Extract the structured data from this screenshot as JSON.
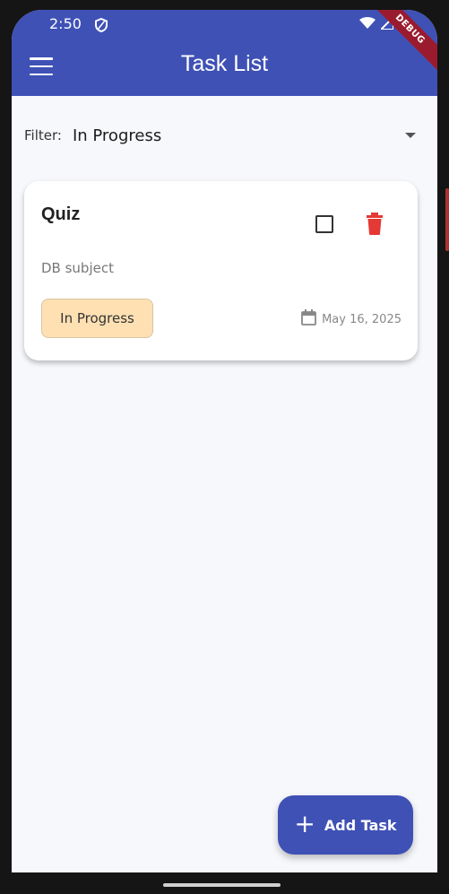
{
  "status_bar": {
    "time": "2:50"
  },
  "app_bar": {
    "title": "Task List",
    "debug_label": "DEBUG"
  },
  "filter": {
    "label": "Filter:",
    "selected": "In Progress"
  },
  "tasks": [
    {
      "title": "Quiz",
      "description": "DB subject",
      "status": "In Progress",
      "date": "May 16, 2025",
      "status_color": "#ffe0b2"
    }
  ],
  "fab": {
    "label": "Add Task"
  },
  "colors": {
    "primary": "#3f51b5",
    "delete": "#e53935",
    "background": "#f7f8fc"
  },
  "icons": [
    "menu-icon",
    "shield-icon",
    "wifi-icon",
    "signal-icon",
    "battery-icon",
    "checkbox-icon",
    "delete-icon",
    "calendar-icon",
    "plus-icon"
  ]
}
